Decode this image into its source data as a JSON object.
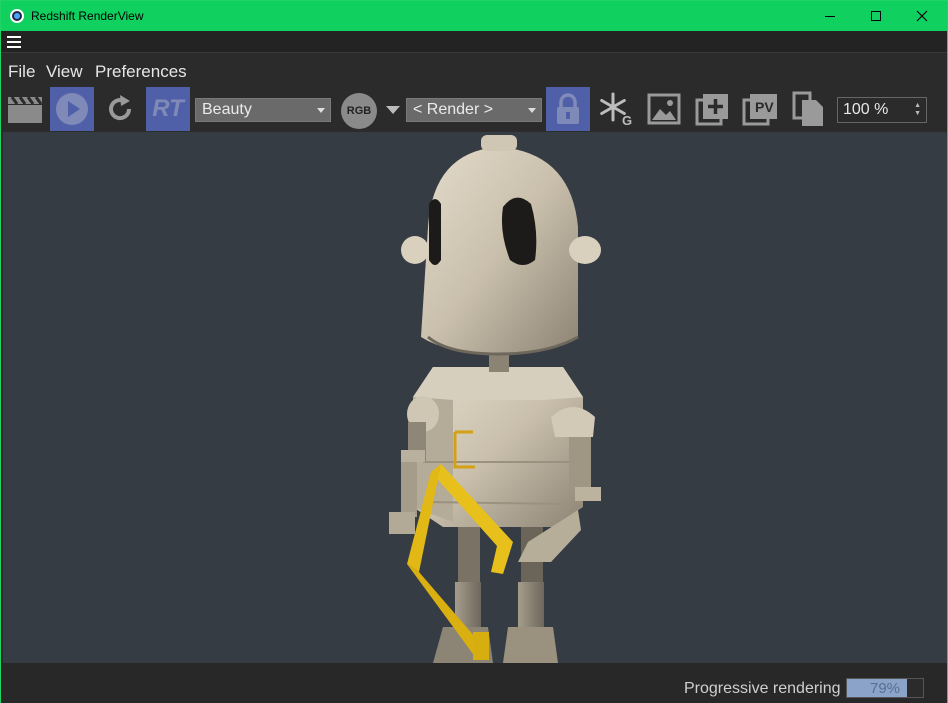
{
  "window": {
    "title": "Redshift RenderView",
    "border_color": "#1fd464",
    "titlebar_color": "#10d060"
  },
  "menu": {
    "items": [
      "File",
      "View",
      "Preferences"
    ]
  },
  "toolbar": {
    "icons": {
      "clapper": "clapperboard-icon",
      "play": "play-icon",
      "refresh": "refresh-icon",
      "rt": "RT",
      "lock": "lock-icon",
      "snowflake": "freeze-icon",
      "image": "image-icon",
      "add_image": "add-image-icon",
      "pv": "PV",
      "copy": "copy-icon"
    },
    "aov_select": "Beauty",
    "channel_label": "RGB",
    "camera_select": "< Render >",
    "zoom": "100 %",
    "active_color": "#5060a8"
  },
  "status": {
    "label": "Progressive rendering",
    "progress_text": "79%",
    "progress_fraction": 0.79,
    "progress_color": "#8ba3c9"
  },
  "viewport": {
    "background": "#363c44"
  }
}
